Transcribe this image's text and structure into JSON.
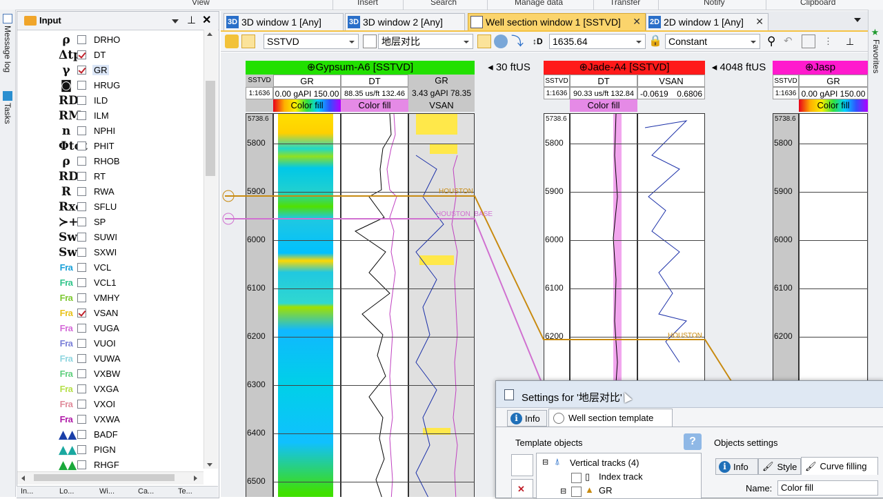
{
  "ribbon": {
    "groups": [
      "View",
      "Insert",
      "Search",
      "Manage data",
      "Transfer",
      "Notify",
      "Clipboard"
    ]
  },
  "left_tabs": {
    "message_log": "Message log",
    "tasks": "Tasks"
  },
  "input_panel": {
    "title": "Input",
    "items": [
      {
        "symbol": "ρ",
        "label": "DRHO",
        "checked": false
      },
      {
        "symbol": "Δtp",
        "label": "DT",
        "checked": true
      },
      {
        "symbol": "γ",
        "label": "GR",
        "checked": true,
        "selected": true
      },
      {
        "symbol": "◙",
        "label": "HRUG",
        "checked": false
      },
      {
        "symbol": "RD",
        "label": "ILD",
        "checked": false
      },
      {
        "symbol": "RM",
        "label": "ILM",
        "checked": false
      },
      {
        "symbol": "n",
        "label": "NPHI",
        "checked": false
      },
      {
        "symbol": "Φtot",
        "label": "PHIT",
        "checked": false
      },
      {
        "symbol": "ρ",
        "label": "RHOB",
        "checked": false
      },
      {
        "symbol": "RD",
        "label": "RT",
        "checked": false
      },
      {
        "symbol": "R",
        "label": "RWA",
        "checked": false
      },
      {
        "symbol": "Rxo",
        "label": "SFLU",
        "checked": false
      },
      {
        "symbol": "≻+",
        "label": "SP",
        "checked": false
      },
      {
        "symbol": "Sw",
        "label": "SUWI",
        "checked": false
      },
      {
        "symbol": "Sw",
        "label": "SXWI",
        "checked": false
      },
      {
        "symbol": "Fra",
        "label": "VCL",
        "checked": false,
        "color": "#1aa0d8"
      },
      {
        "symbol": "Fra",
        "label": "VCL1",
        "checked": false,
        "color": "#2fc48a"
      },
      {
        "symbol": "Fra",
        "label": "VMHY",
        "checked": false,
        "color": "#7dc832"
      },
      {
        "symbol": "Fra",
        "label": "VSAN",
        "checked": true,
        "color": "#e8c21a"
      },
      {
        "symbol": "Fra",
        "label": "VUGA",
        "checked": false,
        "color": "#d46ad8"
      },
      {
        "symbol": "Fra",
        "label": "VUOI",
        "checked": false,
        "color": "#7a7fd8"
      },
      {
        "symbol": "Fra",
        "label": "VUWA",
        "checked": false,
        "color": "#8fd6e0"
      },
      {
        "symbol": "Fra",
        "label": "VXBW",
        "checked": false,
        "color": "#5fcf7d"
      },
      {
        "symbol": "Fra",
        "label": "VXGA",
        "checked": false,
        "color": "#b6e04a"
      },
      {
        "symbol": "Fra",
        "label": "VXOI",
        "checked": false,
        "color": "#e08a9a"
      },
      {
        "symbol": "Fra",
        "label": "VXWA",
        "checked": false,
        "color": "#b01aa8"
      },
      {
        "symbol": "▲▲",
        "label": "BADF",
        "checked": false,
        "color": "#1a3fa8"
      },
      {
        "symbol": "▲▲",
        "label": "PIGN",
        "checked": false,
        "color": "#1aa8a0"
      },
      {
        "symbol": "▲▲",
        "label": "RHGF",
        "checked": false,
        "color": "#1aa83a"
      }
    ],
    "bottom_tabs": [
      "In...",
      "Lo...",
      "Wi...",
      "Ca...",
      "Te..."
    ]
  },
  "doc_tabs": [
    {
      "label": "3D window 1 [Any]",
      "active": false
    },
    {
      "label": "3D window 2 [Any]",
      "active": false
    },
    {
      "label": "Well section window 1 [SSTVD]",
      "active": true
    },
    {
      "label": "2D window 1 [Any]",
      "active": false
    }
  ],
  "toolbar": {
    "domain": "SSTVD",
    "template": "地层对比",
    "depth": "1635.64",
    "lock_mode": "Constant"
  },
  "favorites": "Favorites",
  "well_section": {
    "gap1": "30 ftUS",
    "gap2": "4048 ftUS",
    "wells": [
      {
        "name": "Gypsum-A6 [SSTVD]",
        "color": "#22e000",
        "index": "SSTVD",
        "scale": "1:1636",
        "top_depth": "5738.6",
        "tracks": [
          {
            "name": "GR",
            "range": "0.00 gAPI 150.00",
            "fill": "Color fill"
          },
          {
            "name": "DT",
            "range": "88.35 us/ft 132.46",
            "fill": "Color fill"
          },
          {
            "name": "GR",
            "range": "3.43 gAPI 78.35",
            "fill": "VSAN"
          }
        ]
      },
      {
        "name": "Jade-A4 [SSTVD]",
        "color": "#ff1a1a",
        "index": "SSTVD",
        "scale": "1:1636",
        "top_depth": "5738.6",
        "tracks": [
          {
            "name": "DT",
            "range": "90.33 us/ft 132.84",
            "fill": "Color fill"
          },
          {
            "name": "VSAN",
            "range_min": "-0.0619",
            "range_max": "0.6806",
            "fill": ""
          }
        ]
      },
      {
        "name": "Jasp",
        "color": "#ff1acd",
        "index": "SSTVD",
        "scale": "1:1636",
        "top_depth": "5738.6",
        "tracks": [
          {
            "name": "GR",
            "range": "0.00 gAPI 150.00",
            "fill": "Color fill"
          }
        ]
      }
    ],
    "depth_ticks": [
      "5800",
      "5900",
      "6000",
      "6100",
      "6200",
      "6300",
      "6400",
      "6500"
    ],
    "horizons": [
      "HOUSTON",
      "HOUSTON_BASE"
    ]
  },
  "dialog": {
    "title": "Settings for '地层对比'",
    "tabs": [
      "Info",
      "Well section template"
    ],
    "template_objects_label": "Template objects",
    "objects_settings_label": "Objects settings",
    "tree": [
      {
        "label": "Vertical tracks (4)"
      },
      {
        "label": "Index track"
      },
      {
        "label": "GR"
      }
    ],
    "settings_tabs": [
      "Info",
      "Style",
      "Curve filling"
    ],
    "name_label": "Name:",
    "name_value": "Color fill"
  }
}
